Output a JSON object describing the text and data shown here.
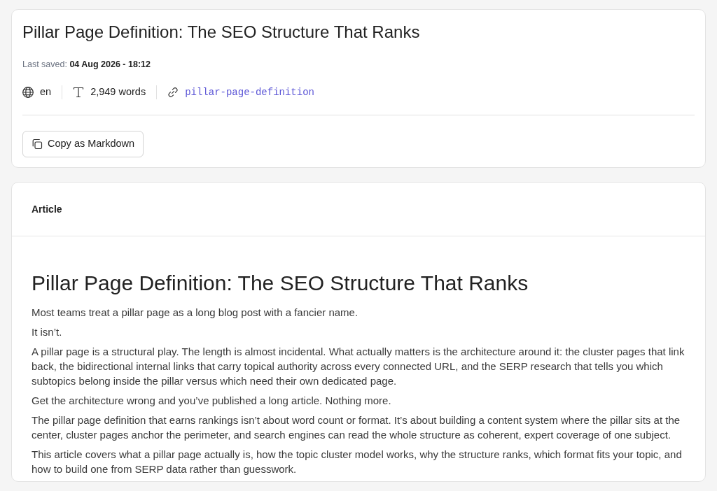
{
  "header_card": {
    "title": "Pillar Page Definition: The SEO Structure That Ranks",
    "last_saved": "Last saved: **04 Aug 2026 - 18:12**",
    "meta": [
      {
        "kind": "language",
        "text": "en"
      },
      {
        "kind": "word_count",
        "text": "2,949 words"
      },
      {
        "kind": "slug",
        "text": "pillar-page-definition"
      }
    ],
    "copy_button": {
      "label": "Copy as Markdown"
    }
  },
  "article_card": {
    "header": "Article",
    "heading": "Pillar Page Definition: The SEO Structure That Ranks",
    "paragraphs": [
      "Most teams treat a pillar page as a long blog post with a fancier name.",
      "It isn’t.",
      "A pillar page is a structural play. The length is almost incidental. What actually matters is the architecture around it: the cluster pages that link back, the bidirectional internal links that carry topical authority across every connected URL, and the SERP research that tells you which subtopics belong inside the pillar versus which need their own dedicated page.",
      "Get the architecture wrong and you’ve published a long article. Nothing more.",
      "The pillar page definition that earns rankings isn’t about word count or format. It’s about building a content system where the pillar sits at the center, cluster pages anchor the perimeter, and search engines can read the whole structure as coherent, expert coverage of one subject.",
      "This article covers what a pillar page actually is, how the topic cluster model works, why the structure ranks, which format fits your topic, and how to build one from SERP data rather than guesswork."
    ]
  }
}
